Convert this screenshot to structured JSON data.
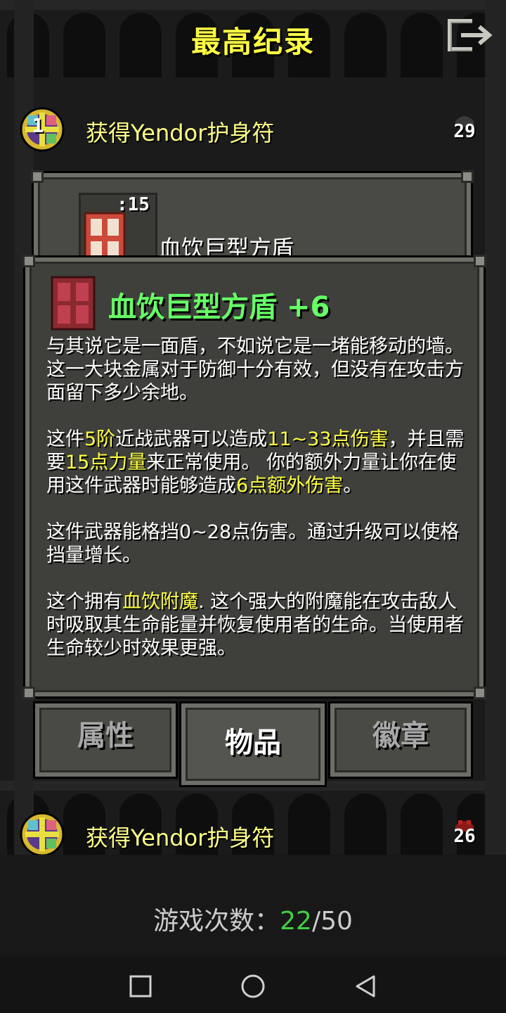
{
  "header": {
    "title": "最高纪录"
  },
  "records": [
    {
      "rank": "1",
      "text": "获得Yendor护身符",
      "level": "29"
    },
    {
      "rank": "",
      "text": "获得Yendor护身符",
      "level": "26"
    }
  ],
  "item_window": {
    "quantity": ":15",
    "name": "血饮巨型方盾"
  },
  "info_window": {
    "title": "血饮巨型方盾 +6",
    "para1": "与其说它是一面盾，不如说它是一堵能移动的墙。这一大块金属对于防御十分有效，但没有在攻击方面留下多少余地。",
    "para2_a": "这件",
    "para2_tier": "5阶",
    "para2_b": "近战武器可以造成",
    "para2_dmg": "11~33点伤害",
    "para2_c": "，并且需要",
    "para2_str": "15点力量",
    "para2_d": "来正常使用。 你的额外力量让你在使用这件武器时能够造成",
    "para2_bonus": "6点额外伤害",
    "para2_e": "。",
    "para3": "这件武器能格挡0~28点伤害。通过升级可以使格挡量增长。",
    "para4_a": "这个拥有",
    "para4_ench": "血饮附魔",
    "para4_b": ". 这个强大的附魔能在攻击敌人时吸取其生命能量并恢复使用者的生命。当使用者生命较少时效果更强。"
  },
  "tabs": {
    "attributes": "属性",
    "items": "物品",
    "badges": "徽章"
  },
  "footer": {
    "games_label": "游戏次数：",
    "games_played": "22",
    "games_total": "/50"
  },
  "colors": {
    "title": "#ffff44",
    "item_title": "#66ff66",
    "highlight": "#ffff44",
    "games_count": "#44cc44"
  },
  "icons": {
    "exit": "exit-icon",
    "amulet": "amulet-icon",
    "shield": "shield-icon",
    "skull": "skull-icon"
  }
}
